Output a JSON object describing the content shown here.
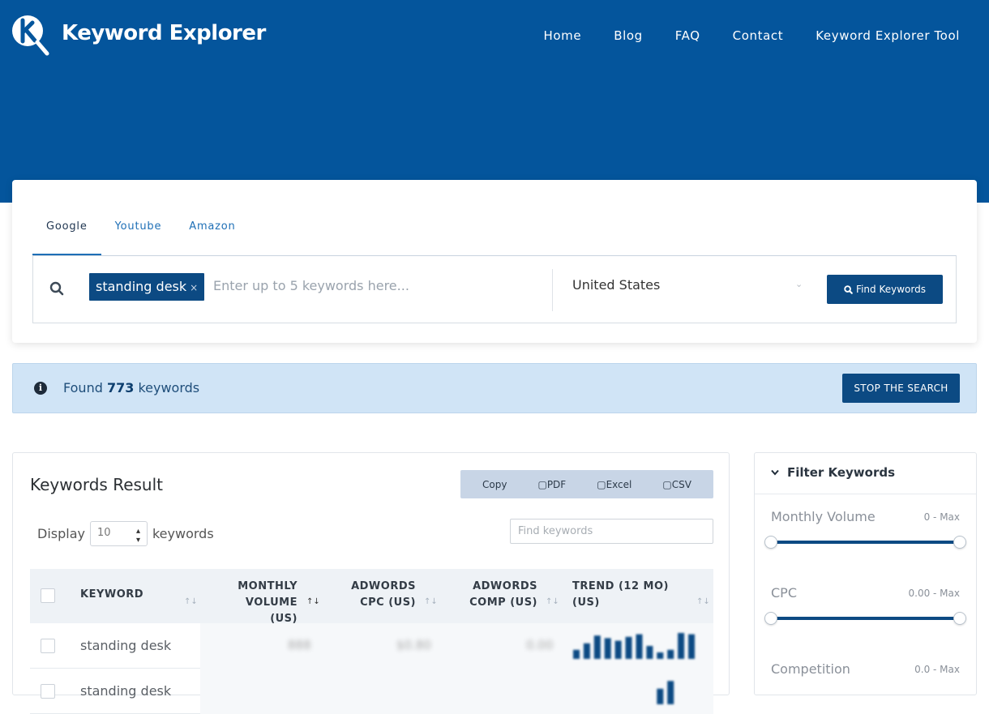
{
  "brand": {
    "name": "Keyword Explorer",
    "colors": {
      "primary": "#04559c",
      "button": "#0c4a83",
      "info_bg": "#d0e4f6"
    }
  },
  "nav": {
    "items": [
      "Home",
      "Blog",
      "FAQ",
      "Contact",
      "Keyword Explorer Tool"
    ]
  },
  "search": {
    "tabs": [
      "Google",
      "Youtube",
      "Amazon"
    ],
    "active_tab": "Google",
    "chip": "standing desk",
    "chip_remove": "×",
    "placeholder": "Enter up to 5 keywords here...",
    "country": "United States",
    "find_button": "Find Keywords"
  },
  "status": {
    "prefix": "Found",
    "count": "773",
    "suffix": "keywords",
    "stop_button": "STOP THE SEARCH"
  },
  "results": {
    "title": "Keywords Result",
    "export": [
      "Copy",
      "PDF",
      "Excel",
      "CSV"
    ],
    "display_label": "Display",
    "display_value": "10",
    "display_suffix": "keywords",
    "find_placeholder": "Find keywords",
    "columns": [
      {
        "line1": "KEYWORD",
        "line2": ""
      },
      {
        "line1": "MONTHLY",
        "line2": "VOLUME (US)"
      },
      {
        "line1": "ADWORDS",
        "line2": "CPC (US)"
      },
      {
        "line1": "ADWORDS",
        "line2": "COMP (US)"
      },
      {
        "line1": "TREND (12 MO)",
        "line2": "(US)"
      }
    ],
    "rows": [
      {
        "keyword": "standing desk",
        "volume": "888",
        "cpc": "$0.80",
        "comp": "0.00",
        "trend": [
          0.35,
          0.6,
          0.9,
          0.8,
          0.7,
          0.85,
          0.95,
          0.5,
          0.25,
          0.35,
          1.0,
          0.95
        ]
      },
      {
        "keyword": "standing desk",
        "volume": "",
        "cpc": "",
        "comp": "",
        "trend": [
          0.0,
          0.0,
          0.0,
          0.0,
          0.0,
          0.0,
          0.0,
          0.0,
          0.6,
          0.9,
          0.0,
          0.0
        ]
      }
    ]
  },
  "filters": {
    "title": "Filter Keywords",
    "items": [
      {
        "label": "Monthly Volume",
        "range": "0 - Max"
      },
      {
        "label": "CPC",
        "range": "0.00 - Max"
      },
      {
        "label": "Competition",
        "range": "0.0 - Max"
      }
    ]
  }
}
